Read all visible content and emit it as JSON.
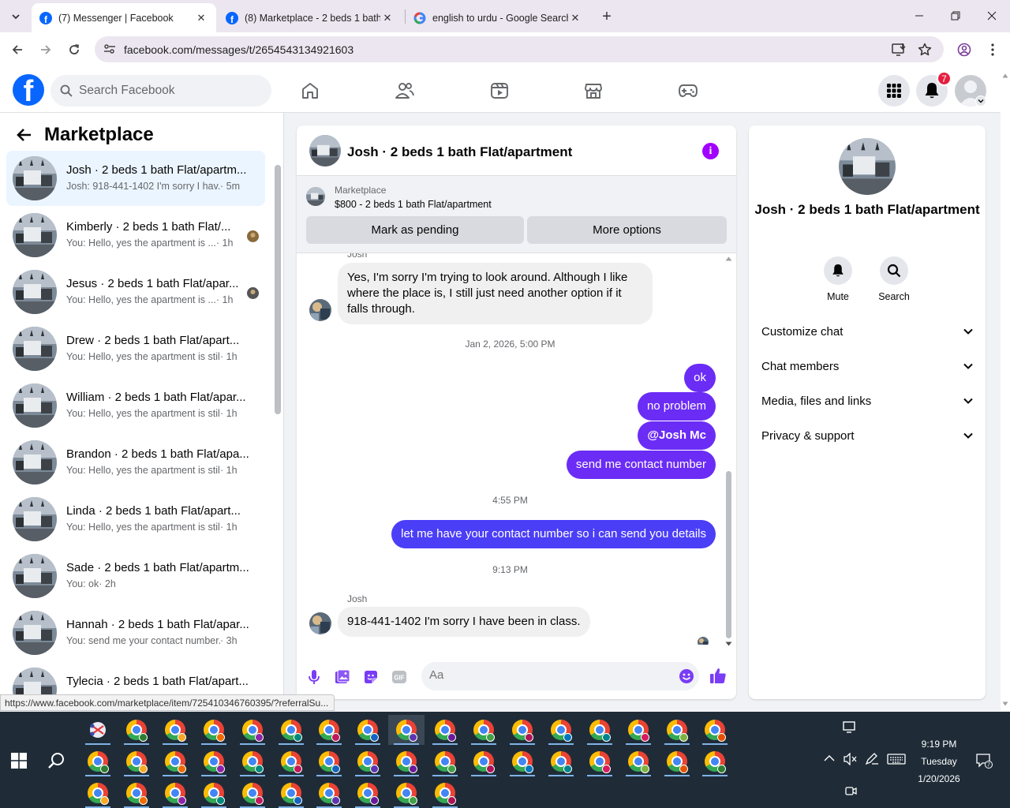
{
  "browser": {
    "tabs": [
      {
        "title": "(7) Messenger | Facebook",
        "active": true
      },
      {
        "title": "(8) Marketplace - 2 beds 1 bath",
        "active": false
      },
      {
        "title": "english to urdu - Google Search",
        "active": false
      }
    ],
    "url": "facebook.com/messages/t/2654543134921603",
    "status_url": "https://www.facebook.com/marketplace/item/725410346760395/?referralSu..."
  },
  "fb": {
    "search_placeholder": "Search Facebook",
    "notification_count": "7"
  },
  "left": {
    "title": "Marketplace",
    "conversations": [
      {
        "name": "Josh · 2 beds 1 bath Flat/apartm...",
        "snippet": "Josh: 918-441-1402 I'm sorry I hav...",
        "time": " · 5m",
        "active": true
      },
      {
        "name": "Kimberly · 2 beds 1 bath Flat/...",
        "snippet": "You: Hello, yes the apartment is ...",
        "time": " · 1h"
      },
      {
        "name": "Jesus · 2 beds 1 bath Flat/apar...",
        "snippet": "You: Hello, yes the apartment is ...",
        "time": " · 1h"
      },
      {
        "name": "Drew · 2 beds 1 bath Flat/apart...",
        "snippet": "You: Hello, yes the apartment is still...",
        "time": " · 1h"
      },
      {
        "name": "William · 2 beds 1 bath Flat/apar...",
        "snippet": "You: Hello, yes the apartment is still...",
        "time": " · 1h"
      },
      {
        "name": "Brandon · 2 beds 1 bath Flat/apa...",
        "snippet": "You: Hello, yes the apartment is still...",
        "time": " · 1h"
      },
      {
        "name": "Linda · 2 beds 1 bath Flat/apart...",
        "snippet": "You: Hello, yes the apartment is still...",
        "time": " · 1h"
      },
      {
        "name": "Sade · 2 beds 1 bath Flat/apartm...",
        "snippet": "You: ok",
        "time": " · 2h"
      },
      {
        "name": "Hannah · 2 beds 1 bath Flat/apar...",
        "snippet": "You: send me your contact number...",
        "time": " · 3h"
      },
      {
        "name": "Tylecia · 2 beds 1 bath Flat/apart...",
        "snippet": "",
        "time": ""
      }
    ]
  },
  "chat": {
    "title": "Josh · 2 beds 1 bath Flat/apartment",
    "marketplace_label": "Marketplace",
    "listing": "$800 - 2 beds 1 bath Flat/apartment",
    "mark_pending": "Mark as pending",
    "more_options": "More options",
    "sender_top": "Josh",
    "msg_in_1": "Yes, I'm sorry I'm trying to look around. Although I like where the place is, I still just need another option if it falls through.",
    "time_1": "Jan 2, 2026, 5:00 PM",
    "out_1": "ok",
    "out_2": "no problem",
    "out_3": "@Josh Mc",
    "out_4": "send me contact number",
    "time_2": "4:55 PM",
    "out_5": "let me have your contact number so i can send you details",
    "time_3": "9:13 PM",
    "sender_bottom": "Josh",
    "msg_in_2": "918-441-1402 I'm sorry I have been in class.",
    "composer_placeholder": "Aa"
  },
  "info": {
    "name": "Josh · 2 beds 1 bath Flat/apartment",
    "mute": "Mute",
    "search": "Search",
    "rows": [
      "Customize chat",
      "Chat members",
      "Media, files and links",
      "Privacy & support"
    ]
  },
  "taskbar": {
    "time": "9:19 PM",
    "day": "Tuesday",
    "date": "1/20/2026"
  },
  "colors": {
    "fb_blue": "#0866ff",
    "outgoing_bubble": "#6b2cf5",
    "info_purple": "#a100ff",
    "badge_red": "#e41e3f"
  }
}
